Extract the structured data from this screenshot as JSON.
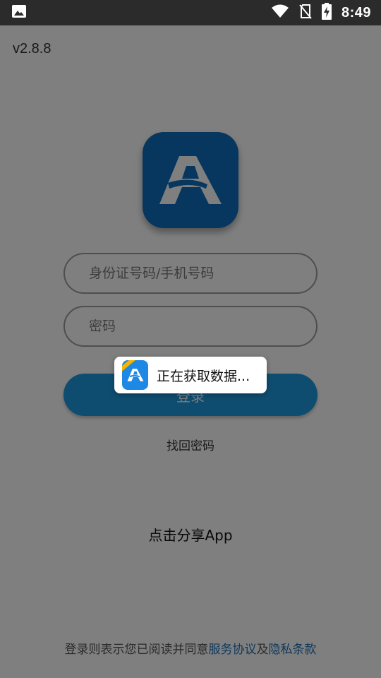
{
  "status_bar": {
    "time": "8:49",
    "icons": [
      "image-icon",
      "wifi-icon",
      "no-sim-icon",
      "battery-charging-icon"
    ]
  },
  "version": "v2.8.8",
  "login": {
    "id_placeholder": "身份证号码/手机号码",
    "password_placeholder": "密码",
    "login_button": "登录",
    "forgot_password": "找回密码"
  },
  "share_label": "点击分享App",
  "terms": {
    "prefix": "登录则表示您已阅读并同意",
    "service_link": "服务协议",
    "and": "及",
    "privacy_link": "隐私条款"
  },
  "toast": {
    "message": "正在获取数据..."
  },
  "colors": {
    "brand_blue": "#0f6cbf",
    "button_blue": "#1e9ae0",
    "link_blue": "#1e72b8",
    "status_bar": "#2b2b2b",
    "overlay": "rgba(0,0,0,0.5)"
  }
}
